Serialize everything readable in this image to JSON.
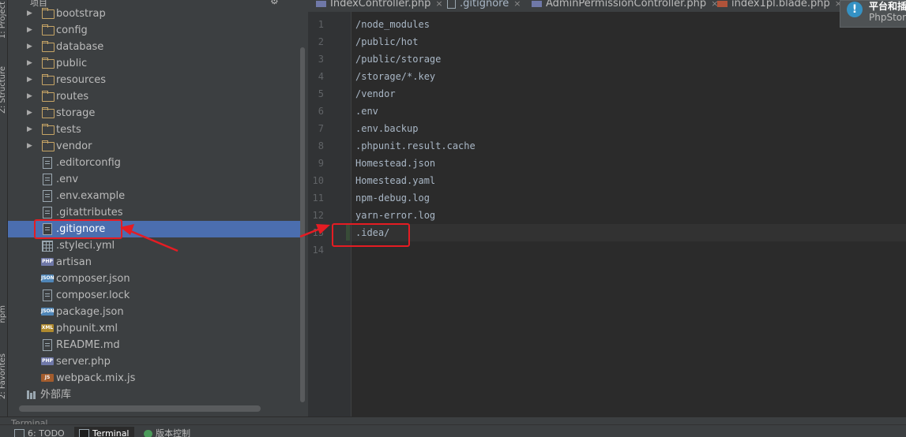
{
  "side_tabs": [
    "1: Project",
    "Z: Structure",
    "npm",
    "2: Favorites"
  ],
  "project_panel": {
    "title": "项目",
    "tree": [
      {
        "type": "folder",
        "label": "bootstrap"
      },
      {
        "type": "folder",
        "label": "config"
      },
      {
        "type": "folder",
        "label": "database"
      },
      {
        "type": "folder",
        "label": "public"
      },
      {
        "type": "folder",
        "label": "resources"
      },
      {
        "type": "folder",
        "label": "routes"
      },
      {
        "type": "folder",
        "label": "storage"
      },
      {
        "type": "folder",
        "label": "tests"
      },
      {
        "type": "folder",
        "label": "vendor"
      },
      {
        "type": "file",
        "label": ".editorconfig"
      },
      {
        "type": "file",
        "label": ".env"
      },
      {
        "type": "file",
        "label": ".env.example"
      },
      {
        "type": "file",
        "label": ".gitattributes"
      },
      {
        "type": "file",
        "label": ".gitignore",
        "selected": true
      },
      {
        "type": "yml",
        "label": ".styleci.yml"
      },
      {
        "type": "php",
        "label": "artisan"
      },
      {
        "type": "json",
        "label": "composer.json"
      },
      {
        "type": "file",
        "label": "composer.lock"
      },
      {
        "type": "json",
        "label": "package.json"
      },
      {
        "type": "xml",
        "label": "phpunit.xml"
      },
      {
        "type": "file",
        "label": "README.md"
      },
      {
        "type": "php",
        "label": "server.php"
      },
      {
        "type": "js",
        "label": "webpack.mix.js"
      },
      {
        "type": "library",
        "label": "外部库"
      }
    ],
    "badges": {
      "php": "PHP",
      "json": "JSON",
      "js": "JS",
      "xml": "XML"
    }
  },
  "editor": {
    "tabs": [
      {
        "label": "IndexController.php",
        "icon": "php-file-icon"
      },
      {
        "label": ".gitignore",
        "icon": "text-file-icon",
        "active": true
      },
      {
        "label": "AdminPermissionController.php",
        "icon": "php-file-icon"
      },
      {
        "label": "index1pl.blade.php",
        "icon": "blade-file-icon"
      }
    ],
    "close_glyph": "×",
    "lines": [
      "/node_modules",
      "/public/hot",
      "/public/storage",
      "/storage/*.key",
      "/vendor",
      ".env",
      ".env.backup",
      ".phpunit.result.cache",
      "Homestead.json",
      "Homestead.yaml",
      "npm-debug.log",
      "yarn-error.log",
      ".idea/",
      ""
    ],
    "caret_line": 13
  },
  "notification": {
    "title": "平台和插件",
    "subtitle": "PhpStorm"
  },
  "bottom": {
    "terminal_header": "Terminal",
    "tools": [
      {
        "label": "6: TODO"
      },
      {
        "label": "Terminal",
        "active": true
      },
      {
        "label": "版本控制"
      }
    ]
  },
  "colors": {
    "annotation_red": "#e51c23",
    "selection": "#4b6eaf"
  }
}
